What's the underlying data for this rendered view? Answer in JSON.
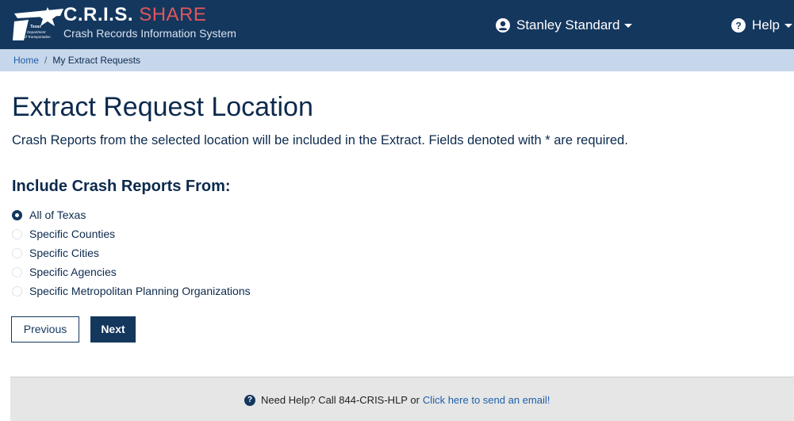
{
  "header": {
    "brand_name": "C.R.I.S.",
    "brand_share": "SHARE",
    "brand_subtitle": "Crash Records Information System",
    "logo_text": [
      "Texas",
      "Department",
      "of Transportation"
    ],
    "user_name": "Stanley Standard",
    "help_label": "Help"
  },
  "breadcrumb": {
    "home": "Home",
    "separator": "/",
    "current": "My Extract Requests"
  },
  "main": {
    "title": "Extract Request Location",
    "description": "Crash Reports from the selected location will be included in the Extract. Fields denoted with * are required.",
    "section_title": "Include Crash Reports From:",
    "options": [
      {
        "label": "All of Texas",
        "selected": true
      },
      {
        "label": "Specific Counties",
        "selected": false
      },
      {
        "label": "Specific Cities",
        "selected": false
      },
      {
        "label": "Specific Agencies",
        "selected": false
      },
      {
        "label": "Specific Metropolitan Planning Organizations",
        "selected": false
      }
    ],
    "previous_label": "Previous",
    "next_label": "Next"
  },
  "footer": {
    "help_text": "Need Help? Call 844-CRIS-HLP or",
    "link_text": "Click here to send an email!"
  },
  "colors": {
    "header_bg": "#14375e",
    "breadcrumb_bg": "#c7d7eb",
    "share_red": "#e0565c",
    "link_blue": "#1c5fa8",
    "footer_bg": "#e6e6e6"
  }
}
